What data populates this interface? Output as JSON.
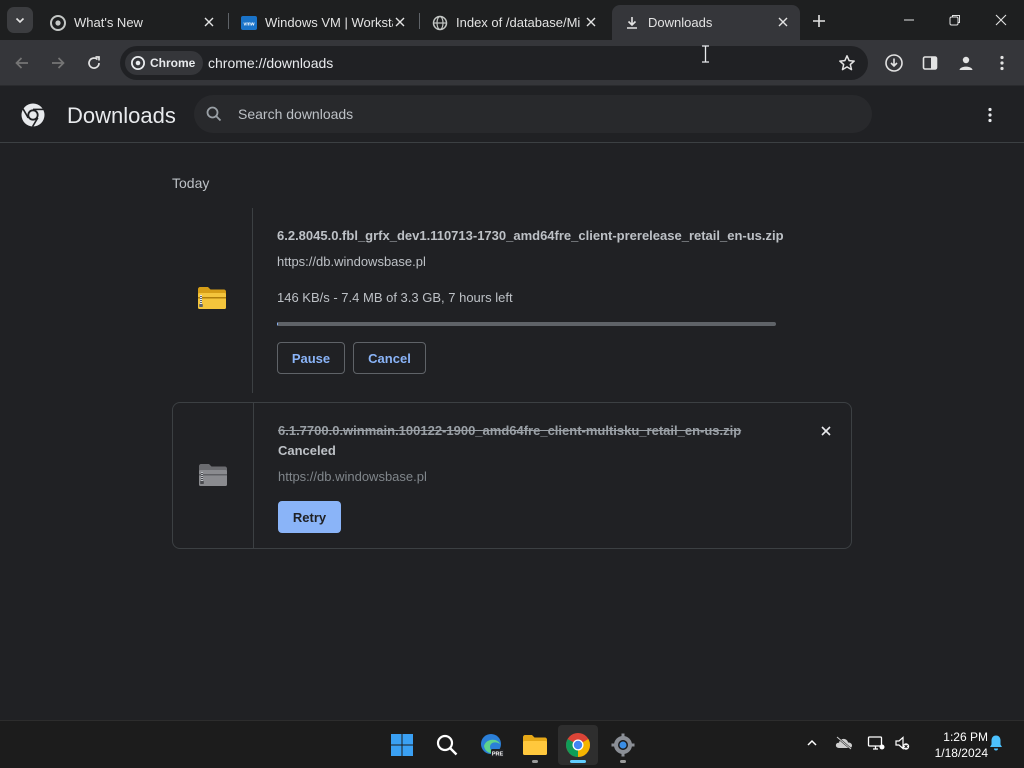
{
  "tabs": [
    {
      "title": "What's New",
      "icon": "chrome-icon",
      "active": false
    },
    {
      "title": "Windows VM | Workstation",
      "icon": "vmware-icon",
      "active": false
    },
    {
      "title": "Index of /database/Mi",
      "icon": "globe-icon",
      "active": false
    },
    {
      "title": "Downloads",
      "icon": "download-icon",
      "active": true
    }
  ],
  "toolbar": {
    "chip_label": "Chrome",
    "url": "chrome://downloads"
  },
  "page": {
    "title": "Downloads",
    "search_placeholder": "Search downloads"
  },
  "section_date": "Today",
  "downloads": [
    {
      "filename": "6.2.8045.0.fbl_grfx_dev1.110713-1730_amd64fre_client-prerelease_retail_en-us.zip",
      "source": "https://db.windowsbase.pl",
      "status": "146 KB/s - 7.4 MB of 3.3 GB, 7 hours left",
      "progress": 0.002,
      "pause_label": "Pause",
      "cancel_label": "Cancel"
    },
    {
      "filename": "6.1.7700.0.winmain.100122-1900_amd64fre_client-multisku_retail_en-us.zip",
      "state_label": "Canceled",
      "source": "https://db.windowsbase.pl",
      "retry_label": "Retry"
    }
  ],
  "taskbar": {
    "time": "1:26 PM",
    "date": "1/18/2024"
  },
  "colors": {
    "accent": "#8ab4f8",
    "background": "#202124",
    "toolbar": "#35363a"
  }
}
